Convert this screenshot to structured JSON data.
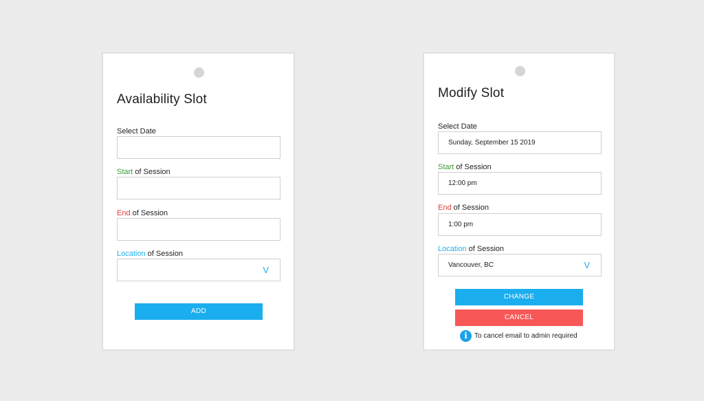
{
  "colors": {
    "background": "#ececec",
    "accent_blue": "#1aaeee",
    "accent_red": "#f85757",
    "label_green": "#3a9a3a",
    "label_red": "#e03c3c",
    "label_blue": "#1fb0ea"
  },
  "availability_card": {
    "title": "Availability Slot",
    "fields": [
      {
        "label": "Select Date",
        "label_accent": "",
        "label_rest": "Select Date",
        "value": ""
      },
      {
        "label_accent": "Start",
        "label_rest": " of Session",
        "value": ""
      },
      {
        "label_accent": "End",
        "label_rest": " of Session",
        "value": ""
      },
      {
        "label_accent": "Location",
        "label_rest": " of Session",
        "value": "",
        "icon": "chevron-down-icon",
        "icon_glyph": "V"
      }
    ],
    "add_button": "ADD"
  },
  "modify_card": {
    "title": "Modify Slot",
    "fields": [
      {
        "label_accent": "",
        "label_rest": "Select Date",
        "value": "Sunday, September 15 2019"
      },
      {
        "label_accent": "Start",
        "label_rest": " of Session",
        "value": "12:00 pm"
      },
      {
        "label_accent": "End",
        "label_rest": " of Session",
        "value": "1:00 pm"
      },
      {
        "label_accent": "Location",
        "label_rest": " of Session",
        "value": "Vancouver, BC",
        "icon": "chevron-down-icon",
        "icon_glyph": "V"
      }
    ],
    "change_button": "CHANGE",
    "cancel_button": "CANCEL",
    "note": {
      "icon": "info-icon",
      "icon_glyph": "i",
      "text": "To cancel email to admin required"
    }
  }
}
